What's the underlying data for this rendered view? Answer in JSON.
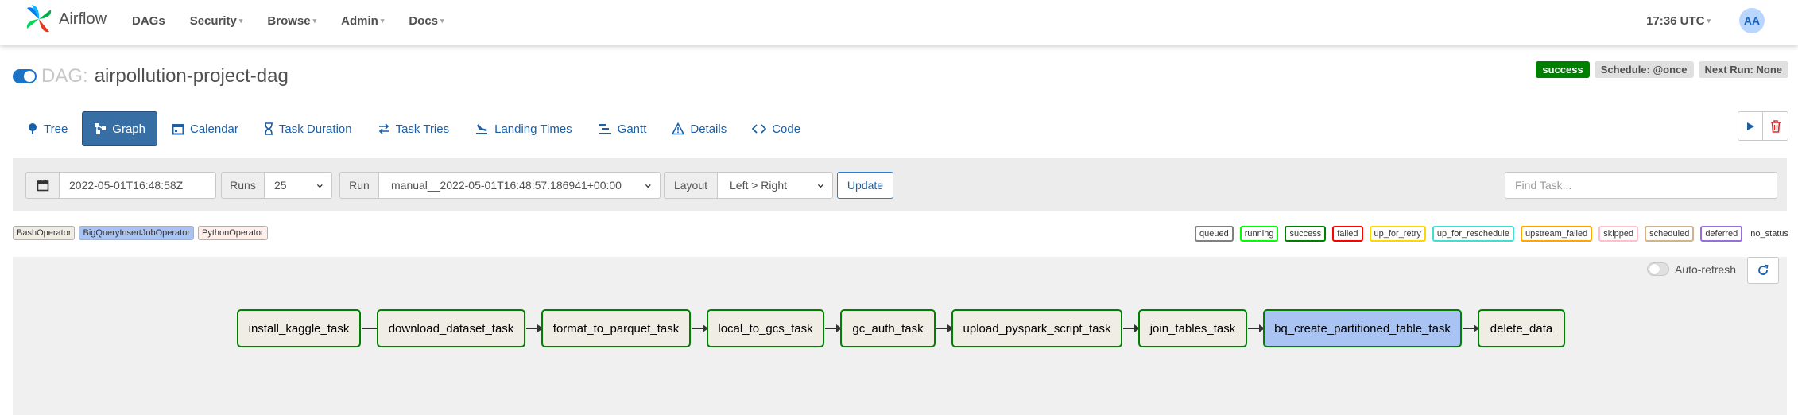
{
  "navbar": {
    "brand": "Airflow",
    "items": [
      {
        "label": "DAGs",
        "dropdown": false
      },
      {
        "label": "Security",
        "dropdown": true
      },
      {
        "label": "Browse",
        "dropdown": true
      },
      {
        "label": "Admin",
        "dropdown": true
      },
      {
        "label": "Docs",
        "dropdown": true
      }
    ],
    "clock": "17:36 UTC",
    "user_initials": "AA"
  },
  "dag": {
    "prefix": "DAG:",
    "id": "airpollution-project-dag",
    "paused": false,
    "badges": {
      "status": "success",
      "schedule": "Schedule: @once",
      "next_run": "Next Run: None"
    }
  },
  "tabs": [
    {
      "label": "Tree",
      "icon": "tree-icon",
      "active": false
    },
    {
      "label": "Graph",
      "icon": "graph-icon",
      "active": true
    },
    {
      "label": "Calendar",
      "icon": "calendar-icon",
      "active": false
    },
    {
      "label": "Task Duration",
      "icon": "hourglass-icon",
      "active": false
    },
    {
      "label": "Task Tries",
      "icon": "retry-icon",
      "active": false
    },
    {
      "label": "Landing Times",
      "icon": "landing-icon",
      "active": false
    },
    {
      "label": "Gantt",
      "icon": "gantt-icon",
      "active": false
    },
    {
      "label": "Details",
      "icon": "warning-icon",
      "active": false
    },
    {
      "label": "Code",
      "icon": "code-icon",
      "active": false
    }
  ],
  "filters": {
    "base_date": "2022-05-01T16:48:58Z",
    "runs_label": "Runs",
    "runs_value": "25",
    "run_label": "Run",
    "run_value": "manual__2022-05-01T16:48:57.186941+00:00",
    "layout_label": "Layout",
    "layout_value": "Left > Right",
    "update_label": "Update",
    "find_task_placeholder": "Find Task..."
  },
  "operators": [
    {
      "label": "BashOperator",
      "color": "#f0ede4"
    },
    {
      "label": "BigQueryInsertJobOperator",
      "color": "#a9c4f2"
    },
    {
      "label": "PythonOperator",
      "color": "#ffefeb"
    }
  ],
  "states": [
    {
      "label": "queued",
      "color": "#808080"
    },
    {
      "label": "running",
      "color": "#00ff00"
    },
    {
      "label": "success",
      "color": "#008000"
    },
    {
      "label": "failed",
      "color": "#ff0000"
    },
    {
      "label": "up_for_retry",
      "color": "#ffd700"
    },
    {
      "label": "up_for_reschedule",
      "color": "#40e0d0"
    },
    {
      "label": "upstream_failed",
      "color": "#ffa500"
    },
    {
      "label": "skipped",
      "color": "#ffc0cb"
    },
    {
      "label": "scheduled",
      "color": "#d2b48c"
    },
    {
      "label": "deferred",
      "color": "#9370db"
    },
    {
      "label": "no_status",
      "color": null
    }
  ],
  "graph": {
    "auto_refresh_label": "Auto-refresh",
    "auto_refresh_on": false,
    "tasks": [
      {
        "label": "install_kaggle_task"
      },
      {
        "label": "download_dataset_task"
      },
      {
        "label": "format_to_parquet_task"
      },
      {
        "label": "local_to_gcs_task"
      },
      {
        "label": "gc_auth_task"
      },
      {
        "label": "upload_pyspark_script_task"
      },
      {
        "label": "join_tables_task"
      },
      {
        "label": "bq_create_partitioned_table_task"
      },
      {
        "label": "delete_data"
      }
    ]
  }
}
